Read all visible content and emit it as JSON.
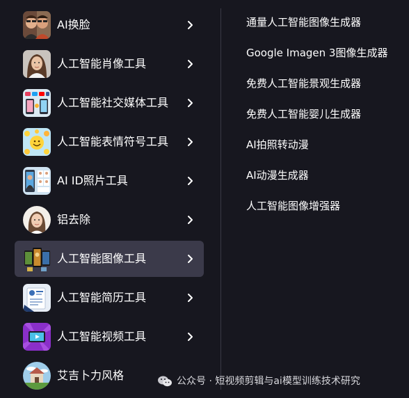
{
  "left_menu": {
    "items": [
      {
        "label": "AI换脸",
        "icon": "face-swap-thumb"
      },
      {
        "label": "人工智能肖像工具",
        "icon": "portrait-thumb"
      },
      {
        "label": "人工智能社交媒体工具",
        "icon": "social-media-thumb"
      },
      {
        "label": "人工智能表情符号工具",
        "icon": "emoji-thumb"
      },
      {
        "label": "AI ID照片工具",
        "icon": "id-photo-thumb"
      },
      {
        "label": "铝去除",
        "icon": "remover-thumb"
      },
      {
        "label": "人工智能图像工具",
        "icon": "image-tools-thumb",
        "active": true
      },
      {
        "label": "人工智能简历工具",
        "icon": "resume-thumb"
      },
      {
        "label": "人工智能视频工具",
        "icon": "video-thumb"
      },
      {
        "label": "艾吉卜力风格",
        "icon": "ghibli-thumb"
      }
    ]
  },
  "right_menu": {
    "items": [
      "通量人工智能图像生成器",
      "Google Imagen 3图像生成器",
      "免费人工智能景观生成器",
      "免费人工智能婴儿生成器",
      "AI拍照转动漫",
      "AI动漫生成器",
      "人工智能图像增强器"
    ]
  },
  "watermark": {
    "text": "公众号 · 短视频剪辑与ai模型训练技术研究"
  },
  "colors": {
    "background": "#17171f",
    "active_item": "#3b3a4a",
    "divider": "#3a3a46",
    "text": "#ffffff"
  }
}
